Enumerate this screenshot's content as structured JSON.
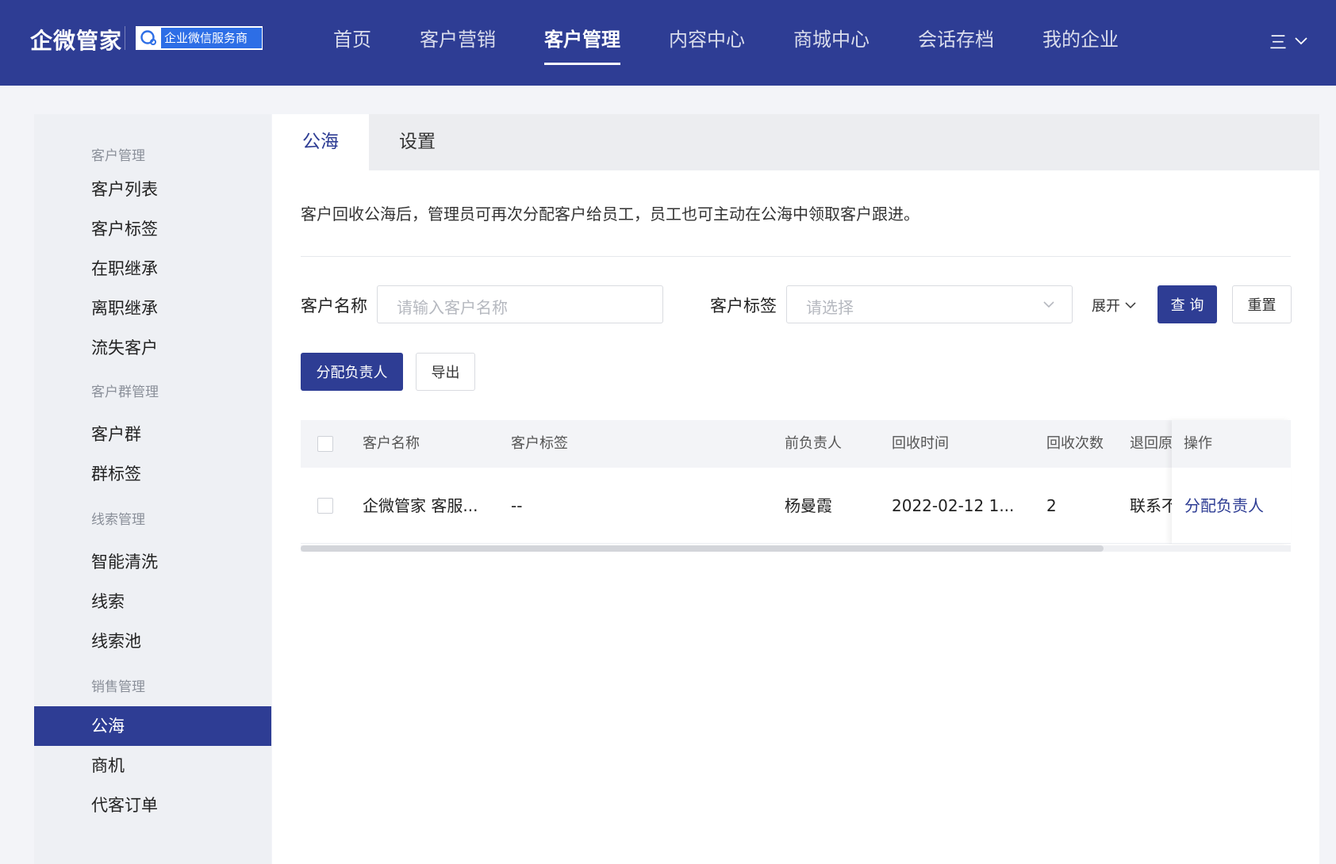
{
  "header": {
    "logo": "企微管家",
    "badge": "企业微信服务商",
    "nav": [
      "首页",
      "客户营销",
      "客户管理",
      "内容中心",
      "商城中心",
      "会话存档",
      "我的企业"
    ],
    "active_nav": "客户管理",
    "menu_icon": "三"
  },
  "sidebar": {
    "sections": [
      {
        "title": "客户管理",
        "items": [
          "客户列表",
          "客户标签",
          "在职继承",
          "离职继承",
          "流失客户"
        ]
      },
      {
        "title": "客户群管理",
        "items": [
          "客户群",
          "群标签"
        ]
      },
      {
        "title": "线索管理",
        "items": [
          "智能清洗",
          "线索",
          "线索池"
        ]
      },
      {
        "title": "销售管理",
        "items": [
          "公海",
          "商机",
          "代客订单"
        ]
      }
    ],
    "active_item": "公海"
  },
  "tabs": [
    "公海",
    "设置"
  ],
  "active_tab": "公海",
  "notice": "客户回收公海后，管理员可再次分配客户给员工，员工也可主动在公海中领取客户跟进。",
  "filters": {
    "name_label": "客户名称",
    "name_placeholder": "请输入客户名称",
    "tag_label": "客户标签",
    "tag_placeholder": "请选择",
    "expand_label": "展开",
    "query_label": "查 询",
    "reset_label": "重置"
  },
  "actions": {
    "assign_label": "分配负责人",
    "export_label": "导出"
  },
  "table": {
    "columns": [
      "客户名称",
      "客户标签",
      "前负责人",
      "回收时间",
      "回收次数",
      "退回原",
      "操作"
    ],
    "rows": [
      {
        "name": "企微管家 客服...",
        "tag": "--",
        "owner": "杨曼霞",
        "time": "2022-02-12 1...",
        "count": "2",
        "reason": "联系不",
        "action": "分配负责人"
      }
    ]
  },
  "colors": {
    "primary": "#2e3d94",
    "header_bg": "#2e3d94",
    "badge_blue": "#2d6ee6"
  }
}
